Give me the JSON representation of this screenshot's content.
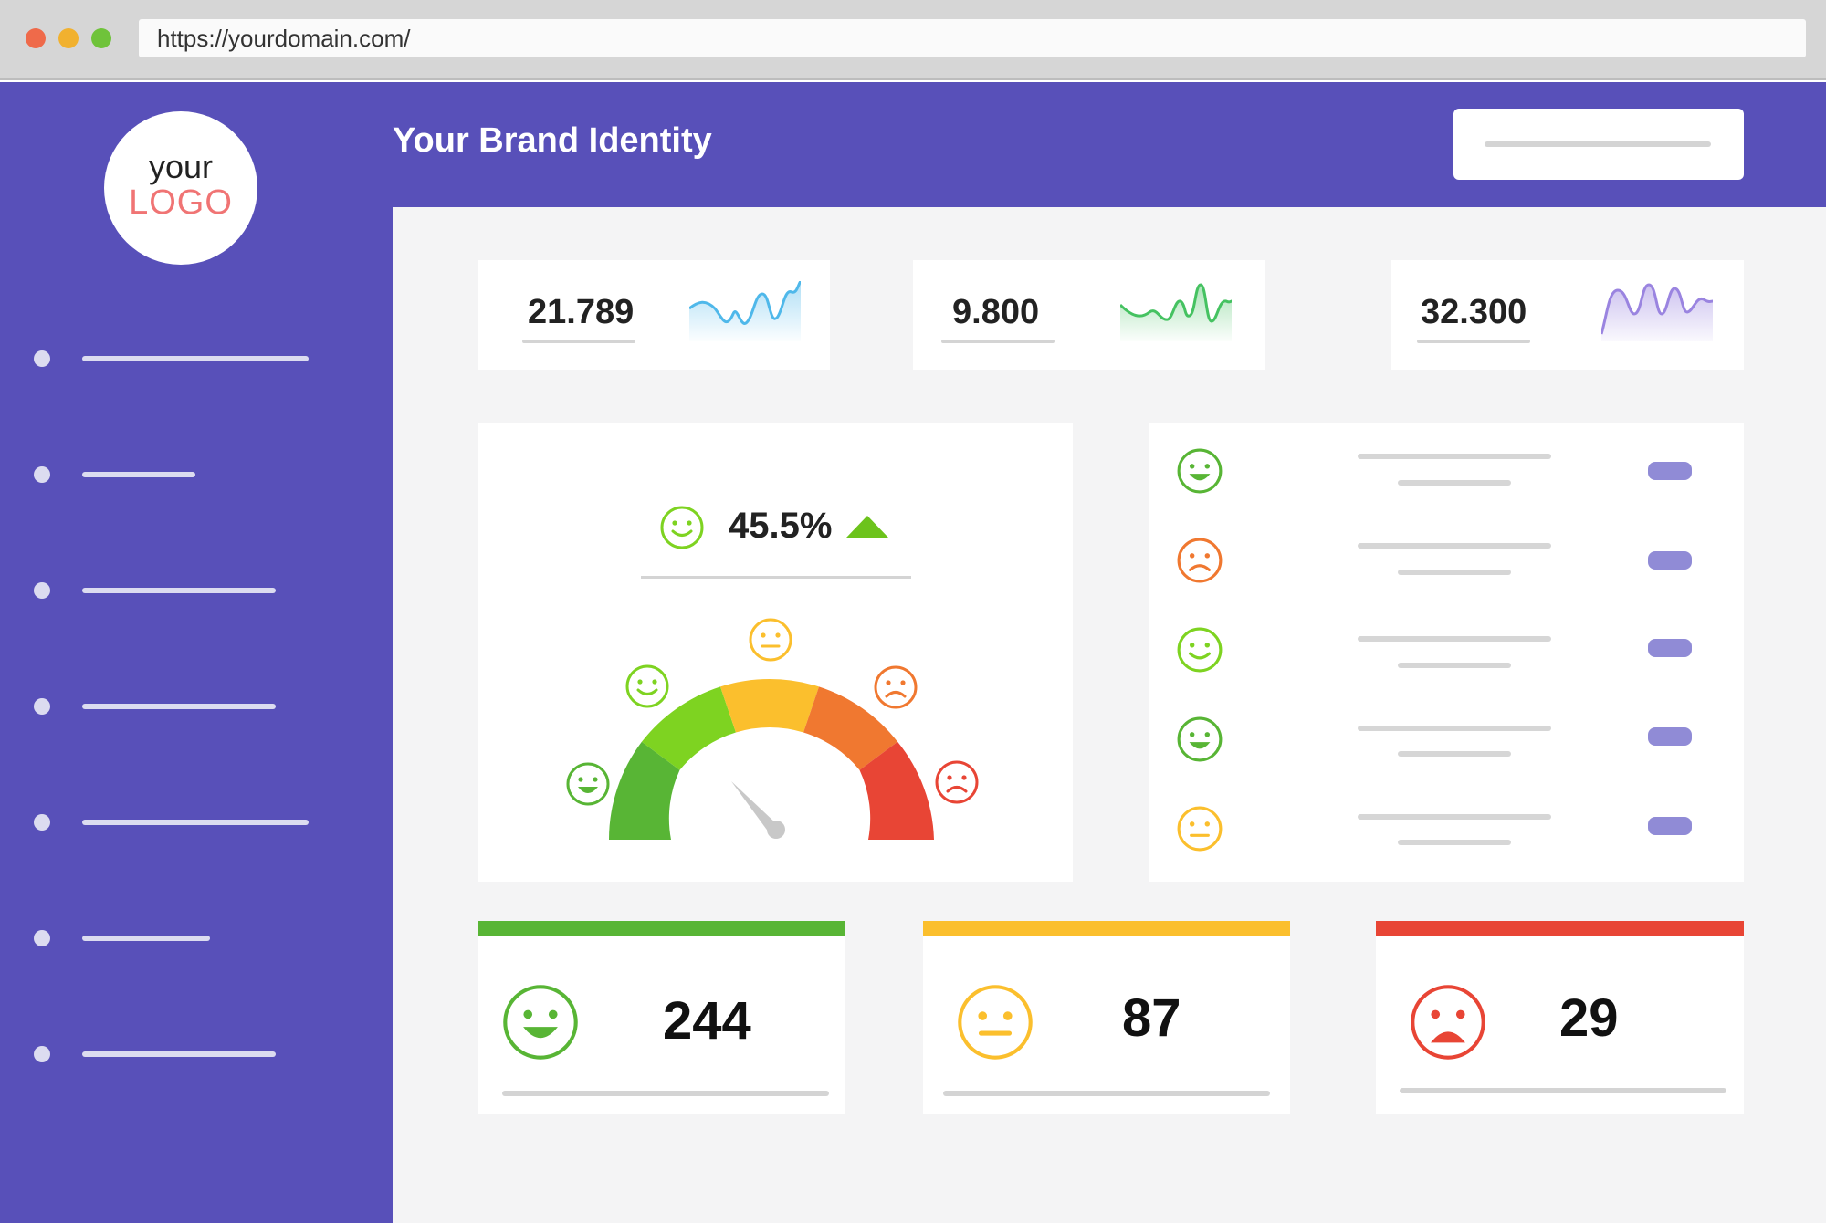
{
  "browser": {
    "url": "https://yourdomain.com/",
    "dots": [
      "#ef6a4a",
      "#f1b12f",
      "#6fc33a"
    ]
  },
  "sidebar": {
    "logo_top": "your",
    "logo_bottom": "LOGO",
    "item_count": 7
  },
  "header": {
    "title": "Your Brand Identity"
  },
  "kpis": [
    {
      "value": "21.789",
      "color": "#4fb8ea"
    },
    {
      "value": "9.800",
      "color": "#45c261"
    },
    {
      "value": "32.300",
      "color": "#9a84e0"
    }
  ],
  "gauge": {
    "value": "45.5%",
    "trend": "up",
    "trend_color": "#6cc31c",
    "segments": [
      "#58b535",
      "#7ed321",
      "#fbbf2d",
      "#f07830",
      "#e84535"
    ],
    "needle_color": "#c8c8c8"
  },
  "ratings": [
    {
      "mood": "happy",
      "color": "#58b535"
    },
    {
      "mood": "sad",
      "color": "#f07830"
    },
    {
      "mood": "smile",
      "color": "#7ed321"
    },
    {
      "mood": "happy",
      "color": "#58b535"
    },
    {
      "mood": "neutral",
      "color": "#fbbf2d"
    }
  ],
  "summary": [
    {
      "mood": "happy",
      "count": "244",
      "color": "#58b535"
    },
    {
      "mood": "neutral",
      "count": "87",
      "color": "#fbbf2d"
    },
    {
      "mood": "sad",
      "count": "29",
      "color": "#e84535"
    }
  ],
  "icons": [
    "happy-face-icon",
    "smile-face-icon",
    "neutral-face-icon",
    "sad-face-icon",
    "triangle-up-icon"
  ]
}
